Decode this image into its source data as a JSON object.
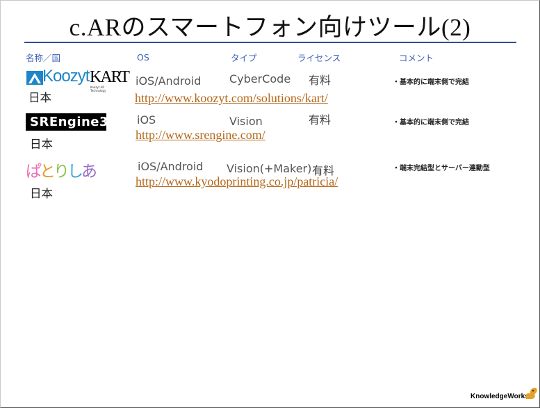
{
  "title": "c.ARのスマートフォン向けツール(2)",
  "headers": {
    "name": "名称／国",
    "os": "OS",
    "type": "タイプ",
    "license": "ライセンス",
    "comment": "コメント"
  },
  "rows": [
    {
      "logo": {
        "brand": "Koozyt",
        "product": "KART",
        "tagline": "Koozyt AR Technology"
      },
      "country": "日本",
      "os": "iOS/Android",
      "type": "CyberCode",
      "license": "有料",
      "comment": "・基本的に端末側で完結",
      "url": "http://www.koozyt.com/solutions/kart/"
    },
    {
      "logo": {
        "brand": "SREngine3"
      },
      "country": "日本",
      "os": "iOS",
      "type": "Vision",
      "license": "有料",
      "comment": "・基本的に端末側で完結",
      "url": "http://www.srengine.com/"
    },
    {
      "logo": {
        "brand": "ぱとりしあ"
      },
      "country": "日本",
      "os": "iOS/Android",
      "type": "Vision(+Maker)",
      "license": "有料",
      "comment": "・端末完結型とサーバー連動型",
      "url": "http://www.kyodoprinting.co.jp/patricia/"
    }
  ],
  "footer": {
    "brand": "KnowledgeWorks"
  },
  "colors": {
    "header_text": "#3a5fb5",
    "title_rule": "#2f4d93",
    "link": "#b4671a",
    "koozyt_blue": "#1e86c8"
  }
}
